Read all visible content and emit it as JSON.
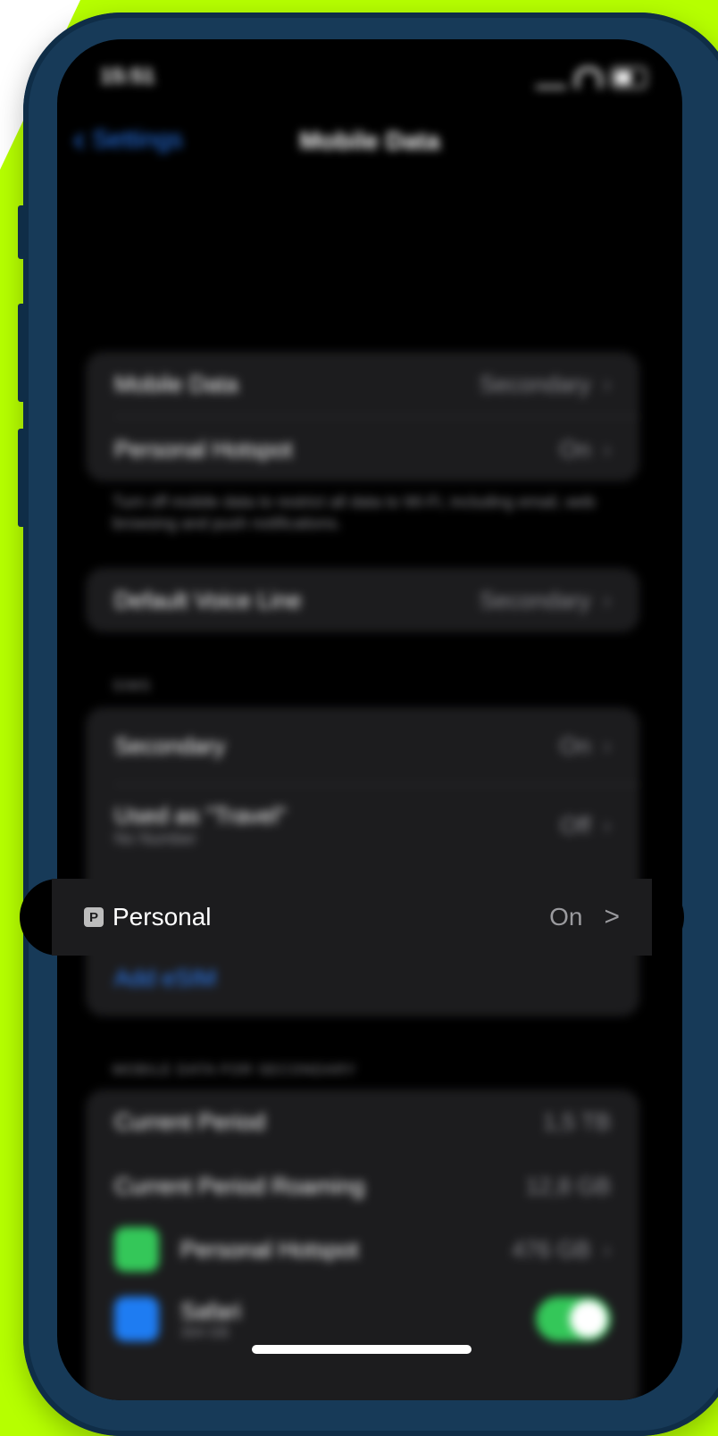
{
  "status_bar": {
    "time": "15:51"
  },
  "nav": {
    "back_label": "Settings",
    "title": "Mobile Data"
  },
  "group1": [
    {
      "label": "Mobile Data",
      "value": "Secondary"
    },
    {
      "label": "Personal Hotspot",
      "value": "On"
    }
  ],
  "group1_note": "Turn off mobile data to restrict all data to Wi-Fi, including email, web browsing and push notifications.",
  "default_voice": {
    "label": "Default Voice Line",
    "value": "Secondary"
  },
  "sims": {
    "header": "SIMs",
    "rows": [
      {
        "label": "Secondary",
        "value": "On"
      },
      {
        "label": "Used as \"Travel\"",
        "sublabel": "No Number",
        "value": "Off"
      }
    ],
    "add_esim": "Add eSIM"
  },
  "highlight_row": {
    "badge": "P",
    "label": "Personal",
    "value": "On",
    "chevron": ">"
  },
  "usage": {
    "header": "MOBILE DATA FOR SECONDARY",
    "rows": [
      {
        "label": "Current Period",
        "value": "1,5 TB"
      },
      {
        "label": "Current Period Roaming",
        "value": "12,8 GB"
      }
    ],
    "apps": [
      {
        "name": "Personal Hotspot",
        "value": "476 GB",
        "color": "#34c759"
      },
      {
        "name": "Safari",
        "sub": "304 GB",
        "color": "#1e7cf2",
        "toggle_on": true
      }
    ]
  },
  "colors": {
    "background": "#b6ff00",
    "phone_frame": "#173a58",
    "accent": "#2c80ff"
  }
}
